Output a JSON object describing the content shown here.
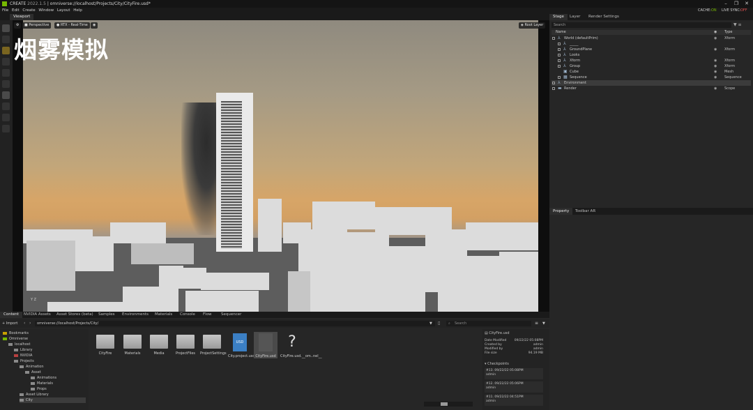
{
  "titlebar": {
    "app": "CREATE",
    "version": "2022.1.5",
    "path": "omniverse://localhost/Projects/City/CityFire.usd*",
    "min": "–",
    "max": "❐",
    "close": "✕"
  },
  "menu": {
    "items": [
      "File",
      "Edit",
      "Create",
      "Window",
      "Layout",
      "Help"
    ],
    "cache_label": "CACHE:",
    "cache_value": "ON",
    "livesync_label": "LIVE SYNC:",
    "livesync_value": "OFF"
  },
  "viewport": {
    "tab": "Viewport",
    "camera": "Perspective",
    "renderer": "RTX - Real-Time",
    "root_layer": "Root Layer",
    "overlay_title": "烟雾模拟",
    "axes": "Y Z"
  },
  "stage": {
    "tabs": [
      "Stage",
      "Layer",
      "Render Settings"
    ],
    "search_placeholder": "Search",
    "col_name": "Name",
    "col_type": "Type",
    "rows": [
      {
        "name": "World (defaultPrim)",
        "type": "Xform"
      },
      {
        "name": "_____",
        "type": ""
      },
      {
        "name": "GroundPlane",
        "type": "Xform"
      },
      {
        "name": "Looks",
        "type": ""
      },
      {
        "name": "Xform",
        "type": "Xform"
      },
      {
        "name": "Group",
        "type": "Xform"
      },
      {
        "name": "Cube",
        "type": "Mesh"
      },
      {
        "name": "Sequence",
        "type": "Sequence"
      },
      {
        "name": "Environment",
        "type": ""
      },
      {
        "name": "Render",
        "type": "Scope"
      }
    ]
  },
  "property": {
    "tabs": [
      "Property",
      "Toolbar AR"
    ]
  },
  "content": {
    "tabs": [
      "Content",
      "NVIDIA Assets",
      "Asset Stores (beta)",
      "Samples",
      "Environments",
      "Materials",
      "Console",
      "Flow",
      "Sequencer"
    ],
    "import_label": "Import",
    "path": "omniverse://localhost/Projects/City/",
    "search_placeholder": "Search",
    "tree": [
      "Bookmarks",
      "Omniverse",
      "localhost",
      "Library",
      "NVIDIA",
      "Projects",
      "Animation",
      "Asset",
      "Animations",
      "Materials",
      "Props",
      "Asset Library",
      "City"
    ],
    "items": [
      "CityFire",
      "Materials",
      "Media",
      "ProjectFiles",
      "ProjectSettings",
      "City.project.usda",
      "CityFire.usd",
      "CityFire.usd.__om..nel__"
    ],
    "detail": {
      "file": "CityFire.usd",
      "date_label": "Date Modified",
      "date_value": "09/22/22 05:08PM",
      "created_label": "Created by",
      "created_value": "admin",
      "modified_label": "Modified by",
      "modified_value": "admin",
      "size_label": "File size",
      "size_value": "94.19 MB",
      "checkpoints_label": "Checkpoints",
      "checkpoints": [
        {
          "id": "#13.",
          "time": "09/22/22 05:08PM",
          "user": "admin"
        },
        {
          "id": "#12.",
          "time": "09/22/22 05:06PM",
          "user": "admin"
        },
        {
          "id": "#11.",
          "time": "09/22/22 04:51PM",
          "user": "admin"
        }
      ]
    }
  }
}
